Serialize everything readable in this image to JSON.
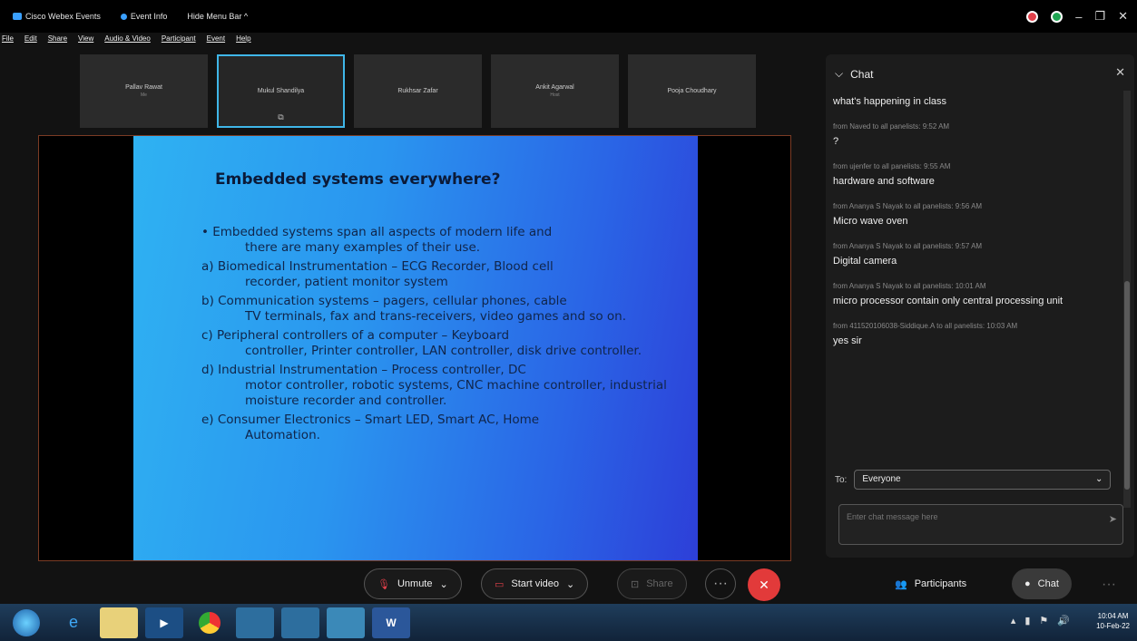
{
  "titlebar": {
    "app_name": "Cisco Webex Events",
    "event_info": "Event Info",
    "hide_menu": "Hide Menu Bar ^"
  },
  "menu": [
    "File",
    "Edit",
    "Share",
    "View",
    "Audio & Video",
    "Participant",
    "Event",
    "Help"
  ],
  "thumbnails": [
    {
      "name": "Pallav Rawat",
      "sub": "Me"
    },
    {
      "name": "Mukul Shandilya",
      "sub": ""
    },
    {
      "name": "Rukhsar Zafar",
      "sub": ""
    },
    {
      "name": "Ankit Agarwal",
      "sub": "Host"
    },
    {
      "name": "Pooja Choudhary",
      "sub": ""
    }
  ],
  "slide": {
    "title": "Embedded systems everywhere?",
    "points": [
      {
        "first": "• Embedded systems span all aspects of modern life and",
        "rest": "there are many examples of their use."
      },
      {
        "first": "a) Biomedical Instrumentation – ECG Recorder, Blood cell",
        "rest": "recorder, patient monitor system"
      },
      {
        "first": "b) Communication systems – pagers, cellular phones, cable",
        "rest": "TV terminals, fax and trans-receivers, video games and so on."
      },
      {
        "first": "c) Peripheral controllers of a computer – Keyboard",
        "rest": "controller, Printer controller, LAN controller, disk drive controller."
      },
      {
        "first": "d) Industrial Instrumentation – Process controller, DC",
        "rest": "motor controller, robotic systems, CNC machine controller, industrial moisture recorder and controller."
      },
      {
        "first": "e) Consumer Electronics – Smart LED, Smart AC,  Home",
        "rest": "Automation."
      }
    ]
  },
  "chat": {
    "title": "Chat",
    "messages": [
      {
        "from": "",
        "text": "what's happening in class"
      },
      {
        "from": "from Naved to all panelists:   9:52 AM",
        "text": "?"
      },
      {
        "from": "from ujenfer to all panelists:   9:55 AM",
        "text": "hardware and software"
      },
      {
        "from": "from Ananya S Nayak to all panelists:   9:56 AM",
        "text": "Micro wave oven"
      },
      {
        "from": "from Ananya S Nayak to all panelists:   9:57 AM",
        "text": "Digital camera"
      },
      {
        "from": "from Ananya S Nayak to all panelists:   10:01 AM",
        "text": "micro processor contain only central processing unit"
      },
      {
        "from": "from 411520106038-Siddique.A to all panelists:   10:03 AM",
        "text": "yes sir"
      }
    ],
    "to_label": "To:",
    "to_value": "Everyone",
    "input_placeholder": "Enter chat message here"
  },
  "controls": {
    "unmute": "Unmute",
    "start_video": "Start video",
    "share": "Share",
    "participants": "Participants",
    "chat": "Chat"
  },
  "taskbar": {
    "time": "10:04 AM",
    "date": "10-Feb-22"
  }
}
